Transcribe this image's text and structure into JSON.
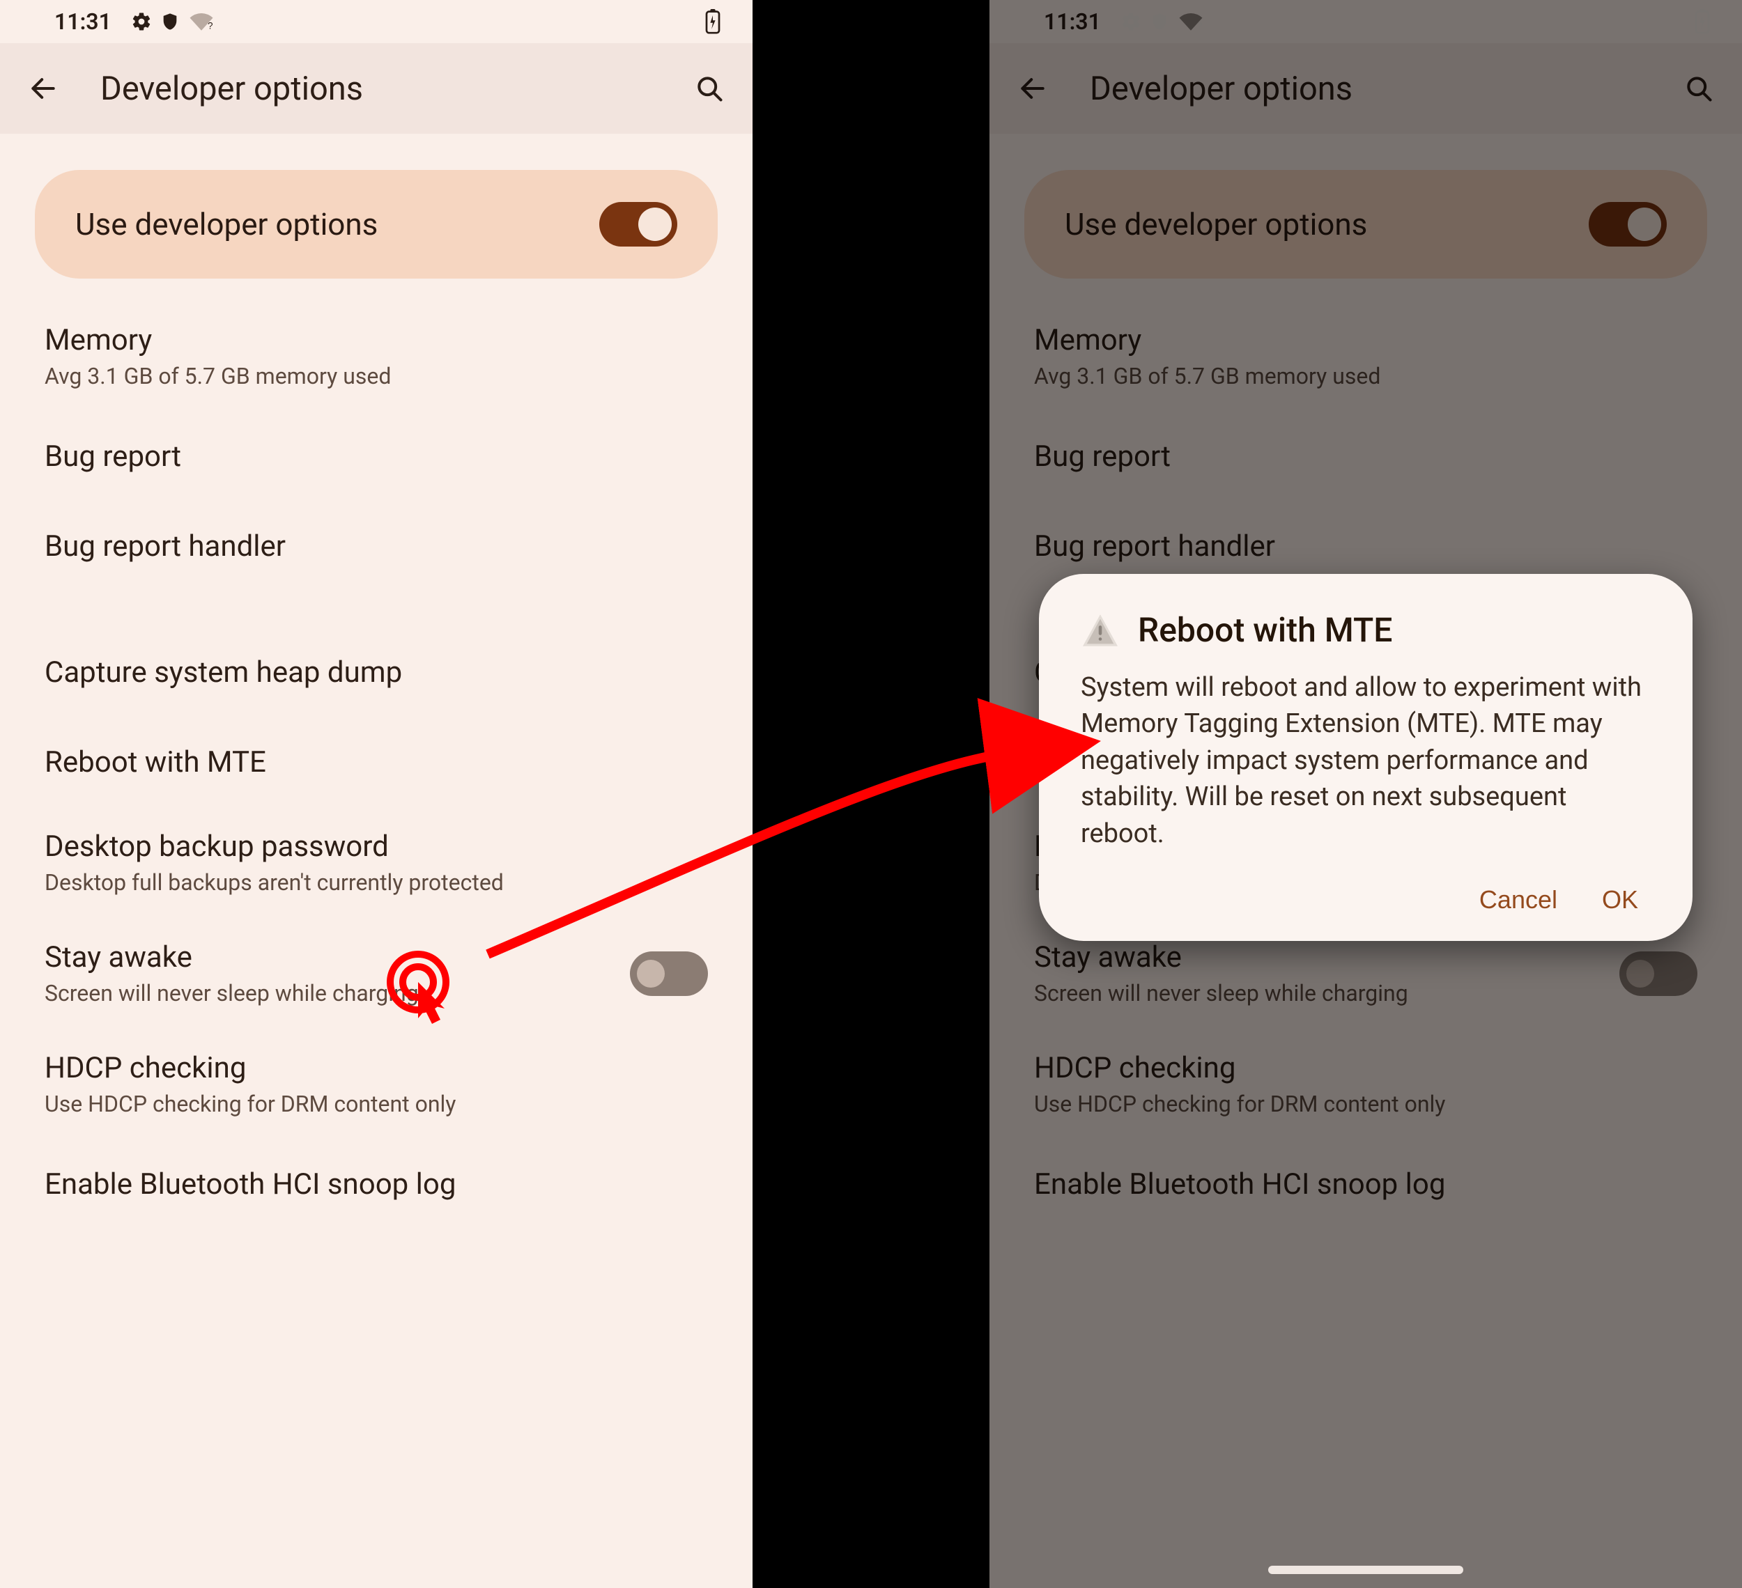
{
  "statusbar": {
    "time": "11:31"
  },
  "header": {
    "title": "Developer options"
  },
  "card": {
    "label": "Use developer options"
  },
  "items": {
    "memory": {
      "title": "Memory",
      "sub": "Avg 3.1 GB of 5.7 GB memory used"
    },
    "bugreport": {
      "title": "Bug report"
    },
    "bughandler": {
      "title": "Bug report handler"
    },
    "heapdump": {
      "title": "Capture system heap dump"
    },
    "mte": {
      "title": "Reboot with MTE"
    },
    "backup": {
      "title": "Desktop backup password",
      "sub": "Desktop full backups aren't currently protected"
    },
    "stayawake": {
      "title": "Stay awake",
      "sub": "Screen will never sleep while charging"
    },
    "hdcp": {
      "title": "HDCP checking",
      "sub": "Use HDCP checking for DRM content only"
    },
    "btsnoop": {
      "title": "Enable Bluetooth HCI snoop log"
    }
  },
  "dialog": {
    "title": "Reboot with MTE",
    "body": "System will reboot and allow to experiment with Memory Tagging Extension (MTE). MTE may negatively impact system performance and stability. Will be reset on next subsequent reboot.",
    "cancel": "Cancel",
    "ok": "OK"
  }
}
